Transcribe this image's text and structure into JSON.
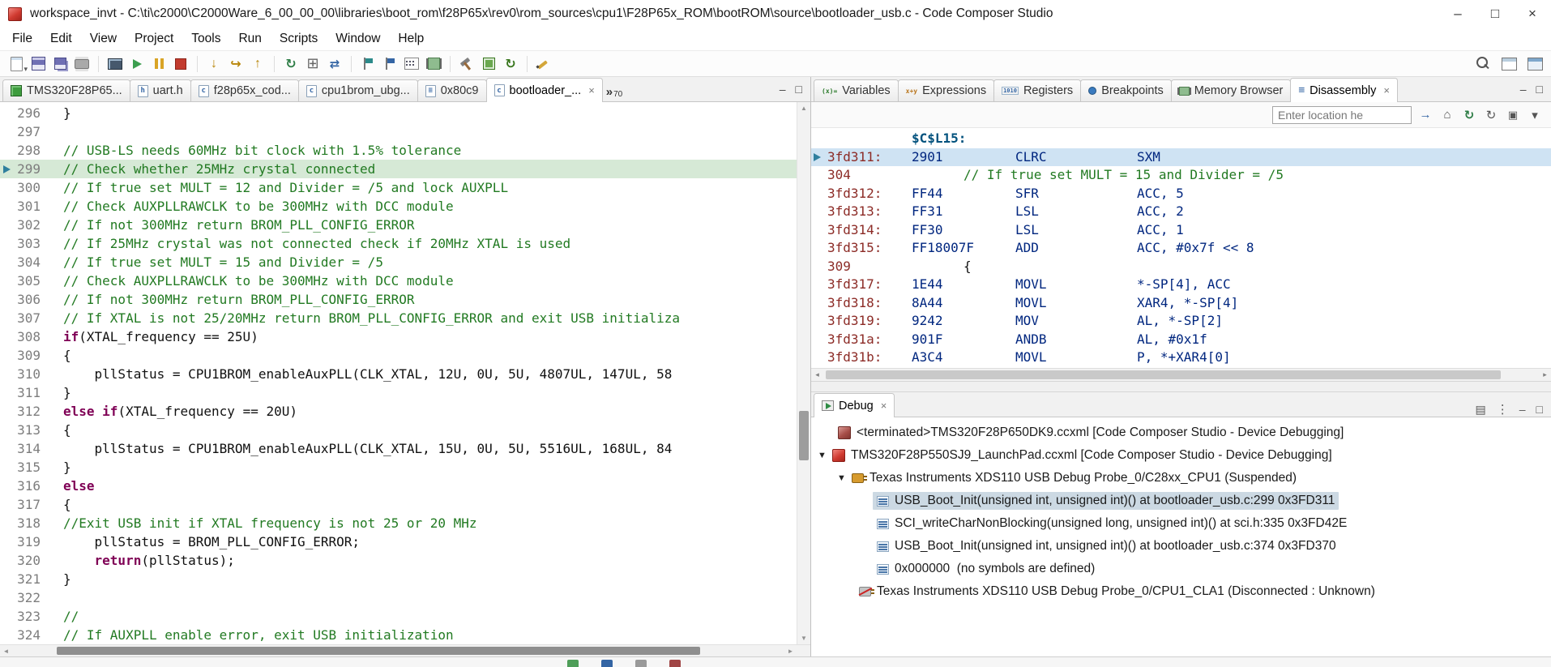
{
  "window_title": "workspace_invt - C:\\ti\\c2000\\C2000Ware_6_00_00_00\\libraries\\boot_rom\\f28P65x\\rev0\\rom_sources\\cpu1\\F28P65x_ROM\\bootROM\\source\\bootloader_usb.c - Code Composer Studio",
  "window_controls": {
    "minimize": "–",
    "maximize": "□",
    "close": "×"
  },
  "menubar": {
    "items": [
      "File",
      "Edit",
      "View",
      "Project",
      "Tools",
      "Run",
      "Scripts",
      "Window",
      "Help"
    ]
  },
  "toolbar": {
    "icon_names": [
      "new-file",
      "save",
      "save-all",
      "print",
      "console",
      "resume",
      "suspend",
      "terminate",
      "step-into",
      "step-over",
      "step-return",
      "restart",
      "registers-grid",
      "swap-target",
      "flag-teal",
      "flag-blue",
      "binary-view",
      "memory-view",
      "build",
      "flash-program",
      "refresh",
      "edit-pencil",
      "search",
      "open-perspective",
      "debug-perspective"
    ]
  },
  "editor_tabs": [
    {
      "label": "TMS320F28P65...",
      "kind": "board"
    },
    {
      "label": "uart.h",
      "glyph": "h"
    },
    {
      "label": "f28p65x_cod...",
      "glyph": "c"
    },
    {
      "label": "cpu1brom_ubg...",
      "glyph": "c"
    },
    {
      "label": "0x80c9",
      "glyph": "≡"
    },
    {
      "label": "bootloader_...",
      "glyph": "c",
      "active": true,
      "close": "×"
    }
  ],
  "editor_tab_overflow": {
    "chevron": "»",
    "count": "70"
  },
  "editor": {
    "lines": [
      {
        "n": "296",
        "code": "}"
      },
      {
        "n": "297"
      },
      {
        "n": "298",
        "cmt": "// USB-LS needs 60MHz bit clock with 1.5% tolerance"
      },
      {
        "n": "299",
        "cmt": "// Check whether 25MHz crystal connected",
        "hl": true
      },
      {
        "n": "300",
        "cmt": "// If true set MULT = 12 and Divider = /5 and lock AUXPLL"
      },
      {
        "n": "301",
        "cmt": "// Check AUXPLLRAWCLK to be 300MHz with DCC module"
      },
      {
        "n": "302",
        "cmt": "// If not 300MHz return BROM_PLL_CONFIG_ERROR"
      },
      {
        "n": "303",
        "cmt": "// If 25MHz crystal was not connected check if 20MHz XTAL is used"
      },
      {
        "n": "304",
        "cmt": "// If true set MULT = 15 and Divider = /5"
      },
      {
        "n": "305",
        "cmt": "// Check AUXPLLRAWCLK to be 300MHz with DCC module"
      },
      {
        "n": "306",
        "cmt": "// If not 300MHz return BROM_PLL_CONFIG_ERROR"
      },
      {
        "n": "307",
        "cmt": "// If XTAL is not 25/20MHz return BROM_PLL_CONFIG_ERROR and exit USB initializa"
      },
      {
        "n": "308",
        "kw": "if",
        "code": "(XTAL_frequency == 25U)"
      },
      {
        "n": "309",
        "code": "{"
      },
      {
        "n": "310",
        "code": "    pllStatus = CPU1BROM_enableAuxPLL(CLK_XTAL, 12U, 0U, 5U, 4807UL, 147UL, 58"
      },
      {
        "n": "311",
        "code": "}"
      },
      {
        "n": "312",
        "kw": "else if",
        "code": "(XTAL_frequency == 20U)"
      },
      {
        "n": "313",
        "code": "{"
      },
      {
        "n": "314",
        "code": "    pllStatus = CPU1BROM_enableAuxPLL(CLK_XTAL, 15U, 0U, 5U, 5516UL, 168UL, 84"
      },
      {
        "n": "315",
        "code": "}"
      },
      {
        "n": "316",
        "kw": "else"
      },
      {
        "n": "317",
        "code": "{"
      },
      {
        "n": "318",
        "cmt": "//Exit USB init if XTAL frequency is not 25 or 20 MHz"
      },
      {
        "n": "319",
        "code": "    pllStatus = BROM_PLL_CONFIG_ERROR;"
      },
      {
        "n": "320",
        "kw": "    return",
        "code": "(pllStatus);"
      },
      {
        "n": "321",
        "code": "}"
      },
      {
        "n": "322"
      },
      {
        "n": "323",
        "cmt": "//"
      },
      {
        "n": "324",
        "cmt": "// If AUXPLL enable error, exit USB initialization"
      }
    ]
  },
  "right_tabs": [
    {
      "label": "Variables",
      "glyph": "(x)="
    },
    {
      "label": "Expressions",
      "glyph": "x+y"
    },
    {
      "label": "Registers",
      "glyph": "1010"
    },
    {
      "label": "Breakpoints"
    },
    {
      "label": "Memory Browser"
    },
    {
      "label": "Disassembly",
      "glyph": "≡",
      "active": true,
      "close": "×"
    }
  ],
  "disassembly": {
    "location_placeholder": "Enter location he",
    "rows": [
      {
        "lbl": "$C$L15:"
      },
      {
        "a": "3fd311:",
        "m": "2901",
        "i": "CLRC",
        "o": "SXM",
        "cur": true
      },
      {
        "a": "304",
        "s": "// If true set MULT = 15 and Divider = /5"
      },
      {
        "a": "3fd312:",
        "m": "FF44",
        "i": "SFR",
        "o": "ACC, 5"
      },
      {
        "a": "3fd313:",
        "m": "FF31",
        "i": "LSL",
        "o": "ACC, 2"
      },
      {
        "a": "3fd314:",
        "m": "FF30",
        "i": "LSL",
        "o": "ACC, 1"
      },
      {
        "a": "3fd315:",
        "m": "FF18007F",
        "i": "ADD",
        "o": "ACC, #0x7f << 8"
      },
      {
        "a": "309",
        "c": "{"
      },
      {
        "a": "3fd317:",
        "m": "1E44",
        "i": "MOVL",
        "o": "*-SP[4], ACC"
      },
      {
        "a": "3fd318:",
        "m": "8A44",
        "i": "MOVL",
        "o": "XAR4, *-SP[4]"
      },
      {
        "a": "3fd319:",
        "m": "9242",
        "i": "MOV",
        "o": "AL, *-SP[2]"
      },
      {
        "a": "3fd31a:",
        "m": "901F",
        "i": "ANDB",
        "o": "AL, #0x1f"
      },
      {
        "a": "3fd31b:",
        "m": "A3C4",
        "i": "MOVL",
        "o": "P, *+XAR4[0]"
      }
    ]
  },
  "debug_panel": {
    "tab_label": "Debug",
    "close": "×",
    "rows": [
      {
        "text": "<terminated>TMS320F28P650DK9.ccxml [Code Composer Studio - Device Debugging]"
      },
      {
        "text": "TMS320F28P550SJ9_LaunchPad.ccxml [Code Composer Studio - Device Debugging]"
      },
      {
        "text": "Texas Instruments XDS110 USB Debug Probe_0/C28xx_CPU1 (Suspended)"
      },
      {
        "text": "USB_Boot_Init(unsigned int, unsigned int)() at bootloader_usb.c:299 0x3FD311",
        "sel": true
      },
      {
        "text": "SCI_writeCharNonBlocking(unsigned long, unsigned int)() at sci.h:335 0x3FD42E"
      },
      {
        "text": "USB_Boot_Init(unsigned int, unsigned int)() at bootloader_usb.c:374 0x3FD370"
      },
      {
        "text": "0x000000  (no symbols are defined)"
      },
      {
        "text": "Texas Instruments XDS110 USB Debug Probe_0/CPU1_CLA1 (Disconnected : Unknown)"
      }
    ]
  },
  "statusbar": {
    "icon_names": [
      "minimized-view-1",
      "minimized-view-2",
      "minimized-view-3",
      "minimized-view-4"
    ]
  },
  "colors": {
    "comment": "#227a22",
    "keyword": "#7f0055",
    "address": "#8c2b26",
    "instr": "#00267f",
    "label": "#00517d",
    "current_line": "#d6e9d6",
    "disasm_current": "#cfe3f3",
    "selection": "#ccd9e3",
    "accent_red": "#cf2e2e"
  }
}
